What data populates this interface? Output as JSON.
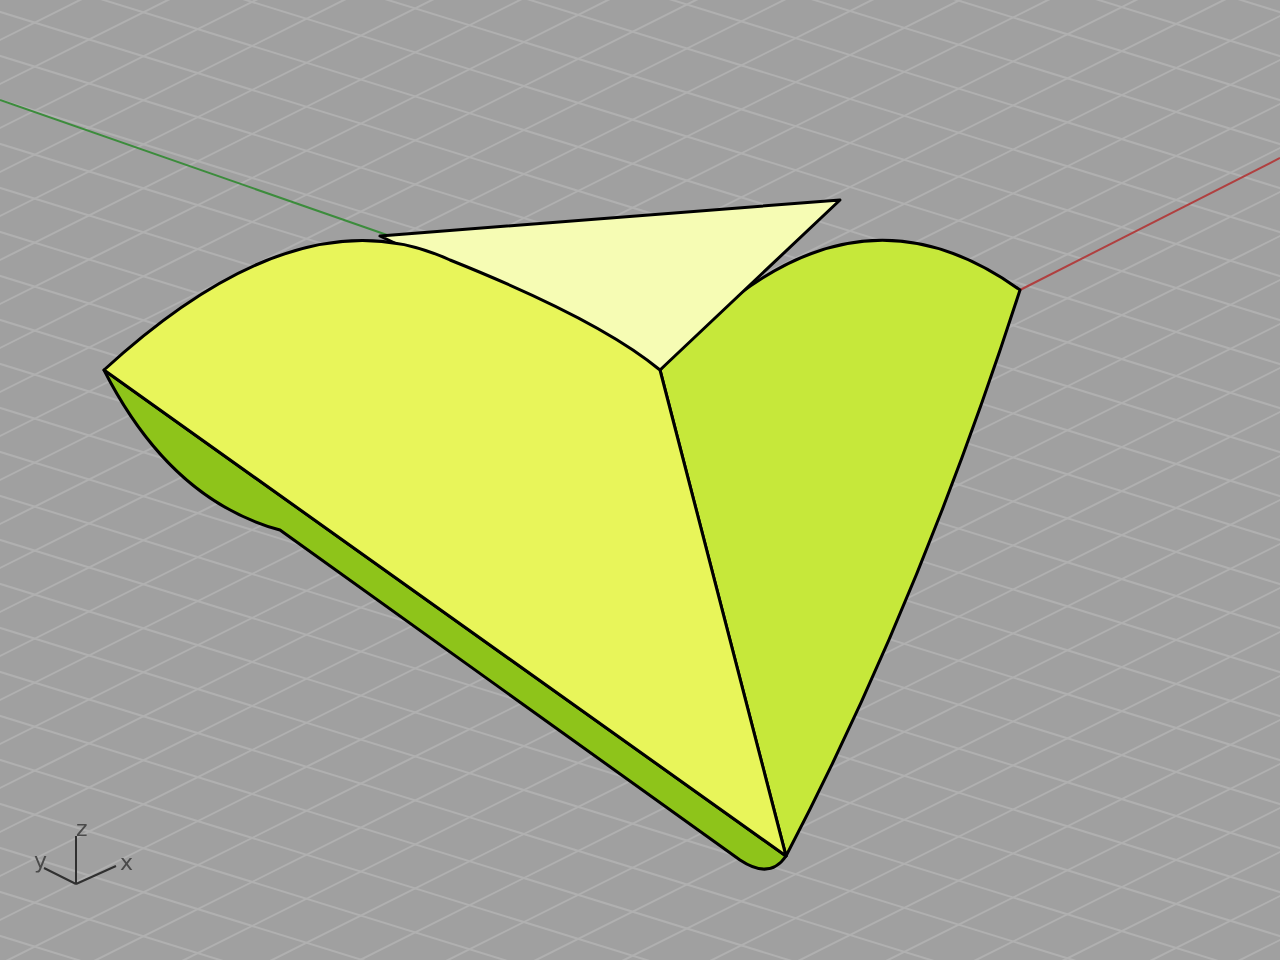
{
  "viewport": {
    "axis_gizmo": {
      "x_label": "x",
      "y_label": "y",
      "z_label": "z"
    }
  }
}
